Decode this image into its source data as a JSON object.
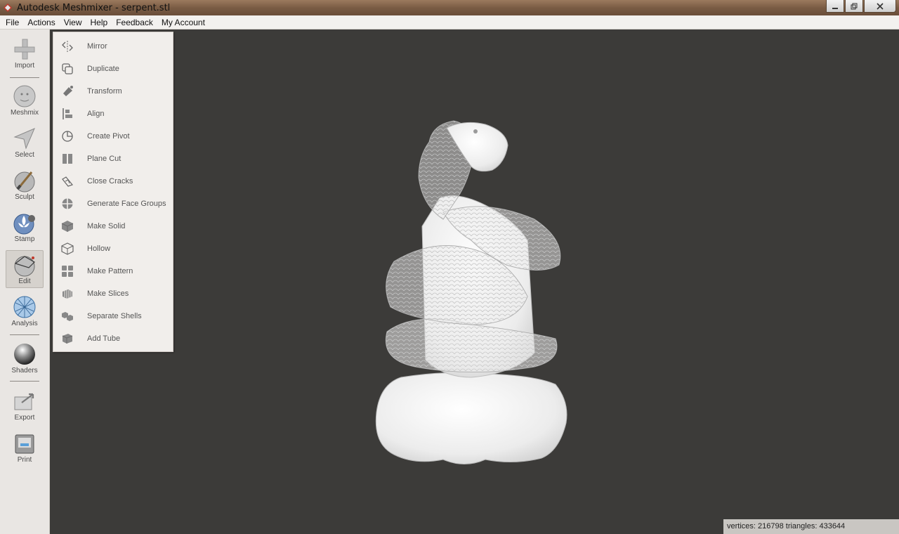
{
  "window": {
    "title": "Autodesk Meshmixer - serpent.stl"
  },
  "menubar": {
    "items": [
      "File",
      "Actions",
      "View",
      "Help",
      "Feedback",
      "My Account"
    ]
  },
  "toolbar": {
    "tools": [
      {
        "label": "Import",
        "icon": "plus-icon"
      },
      {
        "label": "Meshmix",
        "icon": "meshmix-head-icon"
      },
      {
        "label": "Select",
        "icon": "cursor-arrow-icon"
      },
      {
        "label": "Sculpt",
        "icon": "brush-sphere-icon"
      },
      {
        "label": "Stamp",
        "icon": "stamp-fleur-icon"
      },
      {
        "label": "Edit",
        "icon": "edit-sphere-icon",
        "active": true
      },
      {
        "label": "Analysis",
        "icon": "wireframe-sphere-icon"
      },
      {
        "label": "Shaders",
        "icon": "shiny-sphere-icon"
      },
      {
        "label": "Export",
        "icon": "export-arrow-icon"
      },
      {
        "label": "Print",
        "icon": "printer-icon"
      }
    ]
  },
  "edit_panel": {
    "items": [
      {
        "label": "Mirror",
        "icon": "mirror-icon"
      },
      {
        "label": "Duplicate",
        "icon": "duplicate-icon"
      },
      {
        "label": "Transform",
        "icon": "transform-icon"
      },
      {
        "label": "Align",
        "icon": "align-icon"
      },
      {
        "label": "Create Pivot",
        "icon": "pivot-icon"
      },
      {
        "label": "Plane Cut",
        "icon": "plane-cut-icon"
      },
      {
        "label": "Close Cracks",
        "icon": "close-cracks-icon"
      },
      {
        "label": "Generate Face Groups",
        "icon": "face-groups-icon"
      },
      {
        "label": "Make Solid",
        "icon": "solid-cube-icon"
      },
      {
        "label": "Hollow",
        "icon": "hollow-cube-icon"
      },
      {
        "label": "Make Pattern",
        "icon": "pattern-grid-icon"
      },
      {
        "label": "Make Slices",
        "icon": "slices-icon"
      },
      {
        "label": "Separate Shells",
        "icon": "separate-shells-icon"
      },
      {
        "label": "Add Tube",
        "icon": "tube-icon"
      }
    ]
  },
  "status": {
    "text": "vertices: 216798 triangles: 433644"
  },
  "colors": {
    "viewport_bg": "#3c3b39",
    "panel_bg": "#f1eeeb",
    "toolbar_bg": "#e9e6e3",
    "model_fill": "#f5f5f5"
  }
}
